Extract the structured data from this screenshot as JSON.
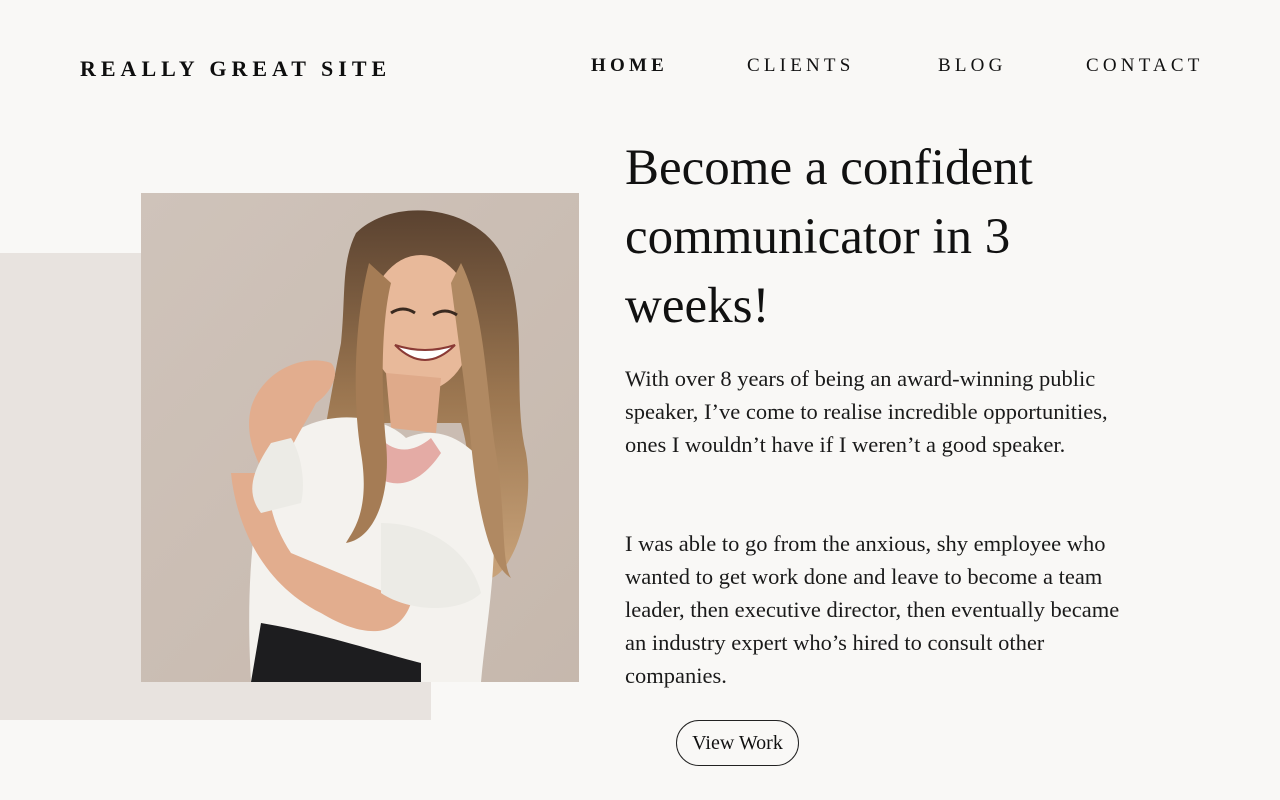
{
  "header": {
    "brand": "REALLY GREAT SITE",
    "nav": [
      {
        "label": "HOME",
        "active": true
      },
      {
        "label": "CLIENTS",
        "active": false
      },
      {
        "label": "BLOG",
        "active": false
      },
      {
        "label": "CONTACT",
        "active": false
      }
    ]
  },
  "hero": {
    "title": "Become a confident communicator in 3 weeks!",
    "paragraphs": [
      "With over 8 years of being an award-winning public speaker, I’ve come to realise incredible opportunities, ones I wouldn’t have if I weren’t a good speaker.",
      "I was able to go from the anxious, shy employee who wanted to get work done and leave to become a team leader, then executive director, then eventually became an industry expert who’s hired to consult other companies."
    ],
    "cta_label": "View Work"
  },
  "colors": {
    "background": "#f9f8f6",
    "accent_block": "#e8e3df",
    "photo_wall": "#ccbfb5",
    "text": "#111111"
  }
}
